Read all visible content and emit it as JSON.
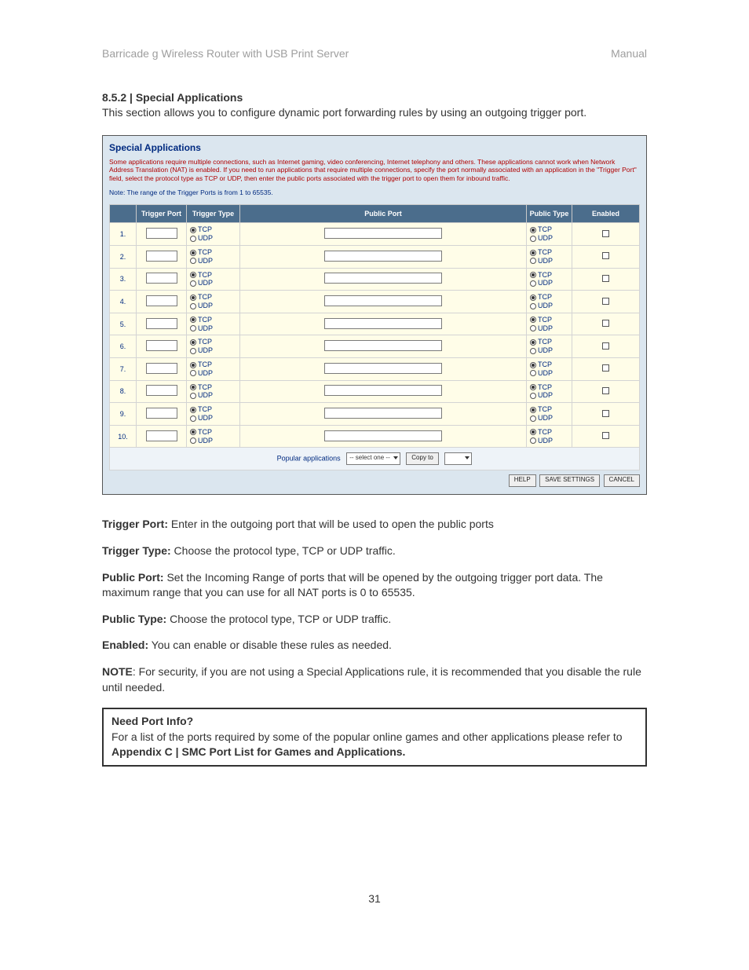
{
  "header": {
    "left": "Barricade g Wireless Router with USB Print Server",
    "right": "Manual"
  },
  "section": {
    "heading": "8.5.2 | Special Applications",
    "intro": "This section allows you to configure dynamic port forwarding rules by using an outgoing trigger port."
  },
  "screenshot": {
    "title": "Special Applications",
    "desc": "Some applications require multiple connections, such as Internet gaming, video conferencing, Internet telephony and others. These applications cannot work when Network Address Translation (NAT) is enabled. If you need to run applications that require multiple connections, specify the port normally associated with an application in the \"Trigger Port\" field, select the protocol type as TCP or UDP, then enter the public ports associated with the trigger port to open them for inbound traffic.",
    "note": "Note: The range of the Trigger Ports is from 1 to 65535.",
    "columns": {
      "trigger_port": "Trigger Port",
      "trigger_type": "Trigger Type",
      "public_port": "Public Port",
      "public_type": "Public Type",
      "enabled": "Enabled"
    },
    "proto": {
      "tcp": "TCP",
      "udp": "UDP"
    },
    "rows": [
      {
        "n": "1."
      },
      {
        "n": "2."
      },
      {
        "n": "3."
      },
      {
        "n": "4."
      },
      {
        "n": "5."
      },
      {
        "n": "6."
      },
      {
        "n": "7."
      },
      {
        "n": "8."
      },
      {
        "n": "9."
      },
      {
        "n": "10."
      }
    ],
    "popular_label": "Popular applications",
    "select_placeholder": "-- select one --",
    "copyto_label": "Copy to",
    "buttons": {
      "help": "HELP",
      "save": "SAVE SETTINGS",
      "cancel": "CANCEL"
    }
  },
  "fields": {
    "trigger_port_label": "Trigger Port:",
    "trigger_port_text": " Enter in the outgoing port that will be used to open the public ports",
    "trigger_type_label": "Trigger Type:",
    "trigger_type_text": " Choose the protocol type, TCP or UDP traffic.",
    "public_port_label": "Public Port:",
    "public_port_text": " Set the Incoming Range of ports that will be opened by the outgoing trigger port data. The maximum range that you can use for all NAT ports is 0 to 65535.",
    "public_type_label": "Public Type:",
    "public_type_text": " Choose the protocol type, TCP or UDP traffic.",
    "enabled_label": "Enabled:",
    "enabled_text": "  You can enable or disable these rules as needed.",
    "note_label": "NOTE",
    "note_text": ": For security, if you are not using a Special Applications rule, it is recommended that you disable the rule until needed."
  },
  "box": {
    "title": "Need Port Info?",
    "line1": "For a list of the ports required by some of the popular online games and other applications please refer to ",
    "appendix": "Appendix C | SMC Port List for Games and Applications."
  },
  "page_number": "31"
}
